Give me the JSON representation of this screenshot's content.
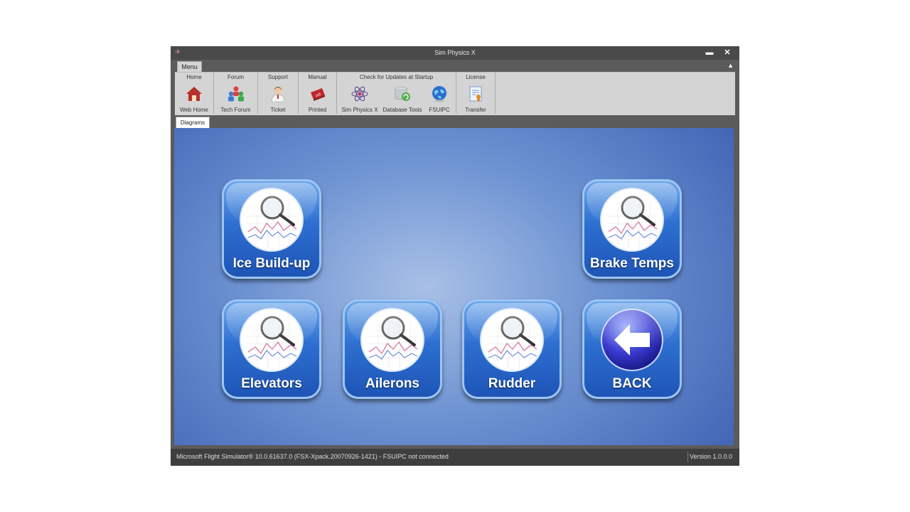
{
  "window": {
    "title": "Sim Physics X",
    "minimize": "▬",
    "close": "✕"
  },
  "ribbon": {
    "menu_tab": "Menu",
    "collapse": "▲",
    "groups": [
      {
        "title": "Home",
        "buttons": [
          {
            "label": "Web Home",
            "icon": "home-icon"
          }
        ]
      },
      {
        "title": "Forum",
        "buttons": [
          {
            "label": "Tech Forum",
            "icon": "people-icon"
          }
        ]
      },
      {
        "title": "Support",
        "buttons": [
          {
            "label": "Ticket",
            "icon": "support-person-icon"
          }
        ]
      },
      {
        "title": "Manual",
        "buttons": [
          {
            "label": "Printed",
            "icon": "pdf-book-icon"
          }
        ]
      },
      {
        "title": "Check for Updates at Startup",
        "buttons": [
          {
            "label": "Sim Physics X",
            "icon": "atom-icon"
          },
          {
            "label": "Database Tools",
            "icon": "database-icon"
          },
          {
            "label": "FSUIPC",
            "icon": "globe-icon"
          }
        ]
      },
      {
        "title": "License",
        "buttons": [
          {
            "label": "Transfer",
            "icon": "certificate-icon"
          }
        ]
      }
    ]
  },
  "tabs": {
    "diagrams": "Diagrams"
  },
  "tiles": {
    "ice": "Ice Build-up",
    "brake": "Brake Temps",
    "elevators": "Elevators",
    "ailerons": "Ailerons",
    "rudder": "Rudder",
    "back": "BACK"
  },
  "status": {
    "left": "Microsoft Flight Simulator® 10.0.61637.0 (FSX-Xpack.20070926-1421)   -  FSUIPC not connected",
    "version": "Version 1.0.0.0"
  },
  "colors": {
    "tile_blue": "#2d6fd0",
    "background_blue": "#6e93d2",
    "chrome_dark": "#4a4a4a",
    "ribbon": "#d4d4d4"
  }
}
